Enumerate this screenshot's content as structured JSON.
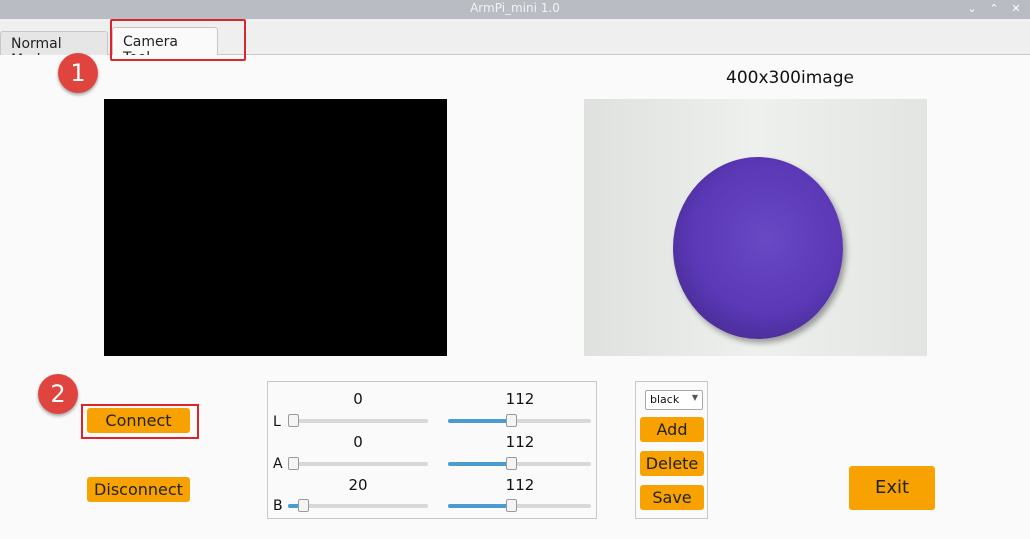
{
  "window": {
    "title": "ArmPi_mini 1.0",
    "controls": [
      "chevron-down",
      "chevron-up",
      "close"
    ]
  },
  "tabs": [
    {
      "label": "Normal Mode"
    },
    {
      "label": "Camera Tool"
    }
  ],
  "annotations": {
    "step1": "1",
    "step2": "2"
  },
  "image_label": "400x300image",
  "buttons": {
    "connect": "Connect",
    "disconnect": "Disconnect",
    "exit": "Exit"
  },
  "sliders": {
    "L": {
      "label": "L",
      "min_value": "0",
      "max_value": "112",
      "min_level": 0,
      "max_level": 112
    },
    "A": {
      "label": "A",
      "min_value": "0",
      "max_value": "112",
      "min_level": 0,
      "max_level": 112
    },
    "B": {
      "label": "B",
      "min_value": "20",
      "max_value": "112",
      "min_level": 20,
      "max_level": 112
    }
  },
  "slider_range": {
    "min": 0,
    "max": 255
  },
  "color": {
    "selected": "black",
    "add": "Add",
    "delete": "Delete",
    "save": "Save"
  },
  "colors": {
    "accent": "#f7a200",
    "highlight": "#d9262b",
    "badge": "#e0443e",
    "slider_fill": "#4a9ad4"
  }
}
